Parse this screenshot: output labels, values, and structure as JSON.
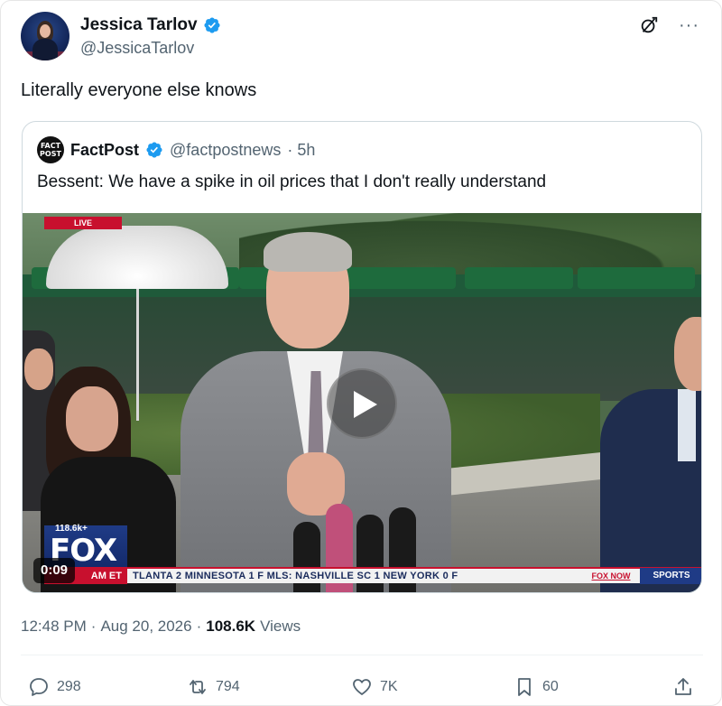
{
  "author": {
    "name": "Jessica Tarlov",
    "handle": "@JessicaTarlov"
  },
  "tweet_text": "Literally everyone else knows",
  "quoted": {
    "avatar_text_line1": "FACT",
    "avatar_text_line2": "POST",
    "name": "FactPost",
    "handle": "@factpostnews",
    "time": "· 5h",
    "text": "Bessent: We have a spike in oil prices that I don't really understand"
  },
  "video": {
    "live_label": "LIVE",
    "fox_views": "118.6k+",
    "fox_word": "FOX",
    "ticker_et": "AM ET",
    "ticker_text": "TLANTA  2  MINNESOTA  1  F  MLS:  NASHVILLE SC  1  NEW YORK  0  F",
    "ticker_brand": "FOX NOW",
    "ticker_sports": "SPORTS",
    "duration": "0:09"
  },
  "meta": {
    "time": "12:48 PM",
    "sep1": "·",
    "date": "Aug 20, 2026",
    "sep2": "·",
    "views_count": "108.6K",
    "views_label": "Views"
  },
  "actions": {
    "replies": "298",
    "reposts": "794",
    "likes": "7K",
    "bookmarks": "60"
  },
  "icons": {
    "verified": "verified-badge-icon",
    "grok": "grok-icon",
    "more": "more-icon",
    "reply": "reply-icon",
    "repost": "repost-icon",
    "like": "heart-icon",
    "bookmark": "bookmark-icon",
    "share": "share-icon",
    "play": "play-icon"
  },
  "colors": {
    "verified_blue": "#1d9bf0",
    "text_primary": "#0f1419",
    "text_secondary": "#536471",
    "fox_red": "#c8102e",
    "fox_blue": "#1f3b86"
  }
}
